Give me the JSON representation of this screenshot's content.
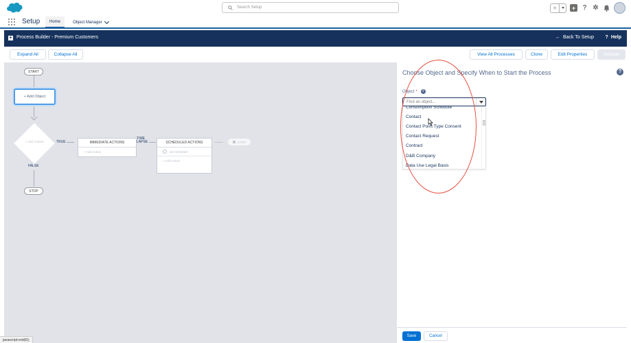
{
  "global_header": {
    "search_placeholder": "Search Setup",
    "icons": [
      "favorites-icon",
      "favorites-list-icon",
      "add-icon",
      "help-icon",
      "setup-gear-icon",
      "notifications-bell-icon",
      "user-avatar"
    ]
  },
  "setup_nav": {
    "app_name": "Setup",
    "tabs": [
      {
        "label": "Home",
        "active": true
      },
      {
        "label": "Object Manager",
        "active": false
      }
    ]
  },
  "builder_bar": {
    "title": "Process Builder - Premium Customers",
    "back_label": "Back To Setup",
    "help_label": "Help"
  },
  "toolbar": {
    "expand_all": "Expand All",
    "collapse_all": "Collapse All",
    "view_all_processes": "View All Processes",
    "clone": "Clone",
    "edit_properties": "Edit Properties",
    "activate": "Activate"
  },
  "canvas": {
    "start": "START",
    "add_object": "+ Add Object",
    "add_criteria": "+ Add Criteria",
    "true_label": "TRUE",
    "false_label": "FALSE",
    "stop": "STOP",
    "immediate_actions": "IMMEDIATE ACTIONS",
    "immediate_add_action": "+ Add Action",
    "time_lapse": "TIME LAPSE",
    "scheduled_actions": "SCHEDULED ACTIONS",
    "set_schedule": "Set Schedule",
    "scheduled_add_action": "+ Add Action",
    "stop_inactive": "STOP"
  },
  "panel": {
    "heading": "Choose Object and Specify When to Start the Process",
    "object_label": "Object",
    "required_mark": "*",
    "object_placeholder": "Find an object...",
    "object_options": [
      "Consumption Schedule",
      "Contact",
      "Contact Point Type Consent",
      "Contact Request",
      "Contract",
      "D&B Company",
      "Data Use Legal Basis"
    ],
    "save": "Save",
    "cancel": "Cancel"
  },
  "colors": {
    "brand_navy": "#16325c",
    "link_blue": "#0070d2",
    "annotation_red": "#e74c3c"
  },
  "status_bar": {
    "text": "javascript:void(0);"
  }
}
